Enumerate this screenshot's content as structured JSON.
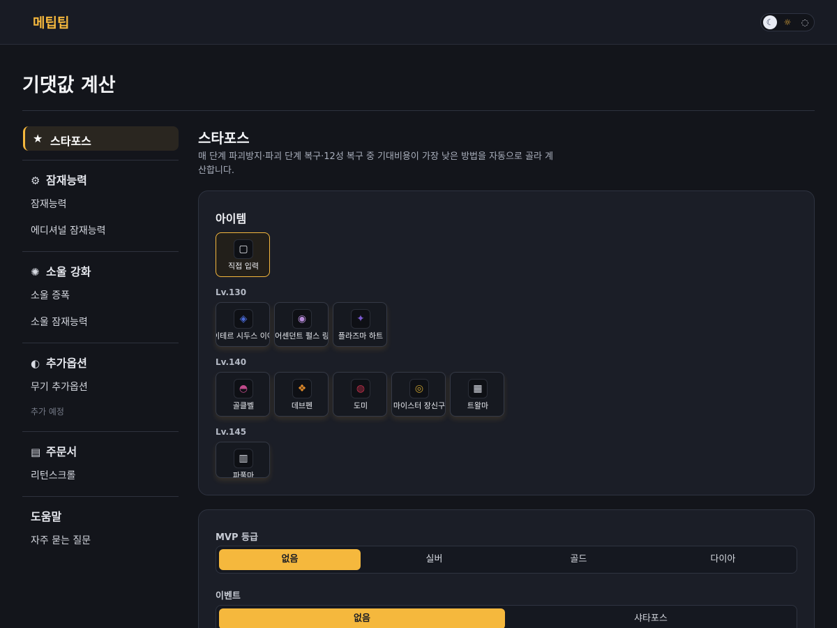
{
  "app": {
    "logo": "메팁팁"
  },
  "theme": {
    "moon_icon": "☾",
    "sun_icon": "☼",
    "system_icon": "◌"
  },
  "page": {
    "title": "기댓값 계산"
  },
  "sidebar": {
    "active": {
      "icon": "★",
      "label": "스타포스"
    },
    "groups": [
      {
        "icon": "⚙",
        "label": "잠재능력",
        "items": [
          "잠재능력",
          "에디셔널 잠재능력"
        ]
      },
      {
        "icon": "✺",
        "label": "소울 강화",
        "items": [
          "소울 증폭",
          "소울 잠재능력"
        ]
      },
      {
        "icon": "◐",
        "label": "추가옵션",
        "items": [
          "무기 추가옵션"
        ],
        "muted": "추가 예정"
      },
      {
        "icon": "▤",
        "label": "주문서",
        "items": [
          "리턴스크롤"
        ]
      },
      {
        "label": "도움말",
        "items": [
          "자주 묻는 질문"
        ]
      }
    ]
  },
  "main": {
    "title": "스타포스",
    "description": "매 단계 파괴방지·파괴 단계 복구·12성 복구 중 기대비용이 가장 낮은 방법을 자동으로 골라 계산합니다.",
    "items_card": {
      "title": "아이템",
      "direct": {
        "label": "직접 입력",
        "icon": "▢"
      },
      "levels": [
        {
          "label": "Lv.130",
          "items": [
            {
              "name": "아이테르 시두스 이어링",
              "color": "#4a6ad8",
              "icon": "◈"
            },
            {
              "name": "어센던트 펄스 링",
              "color": "#b68ad8",
              "icon": "◉"
            },
            {
              "name": "플라즈마 하트",
              "color": "#7b5ad0",
              "icon": "✦"
            }
          ]
        },
        {
          "label": "Lv.140",
          "items": [
            {
              "name": "골클벨",
              "color": "#c04a8a",
              "icon": "◓"
            },
            {
              "name": "데브펜",
              "color": "#e08a2a",
              "icon": "❖"
            },
            {
              "name": "도미",
              "color": "#c0304a",
              "icon": "◍"
            },
            {
              "name": "마이스터 장신구",
              "color": "#c8a030",
              "icon": "◎"
            },
            {
              "name": "트왈마",
              "color": "#d8dbe3",
              "icon": "▦"
            }
          ]
        },
        {
          "label": "Lv.145",
          "items": [
            {
              "name": "파풀마",
              "color": "#d8dbe3",
              "icon": "▥"
            }
          ]
        }
      ]
    },
    "options_card": {
      "mvp": {
        "label": "MVP 등급",
        "options": [
          "없음",
          "실버",
          "골드",
          "다이아"
        ],
        "selected": "없음"
      },
      "event": {
        "label": "이벤트",
        "options": [
          "없음",
          "샤타포스"
        ],
        "selected": "없음"
      }
    }
  },
  "colors": {
    "accent": "#f5b83d",
    "background": "#13151b",
    "card": "#1b1e27"
  }
}
